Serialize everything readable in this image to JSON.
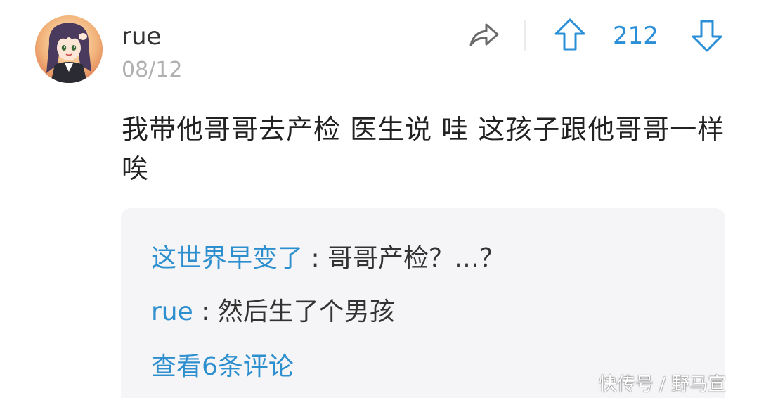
{
  "post": {
    "username": "rue",
    "date": "08/12",
    "body": "我带他哥哥去产检 医生说 哇 这孩子跟他哥哥一样唉",
    "score": "212",
    "icons": {
      "share": "share-icon",
      "upvote": "upvote-arrow-icon",
      "downvote": "downvote-arrow-icon"
    }
  },
  "replies": {
    "items": [
      {
        "author": "这世界早变了",
        "separator": " : ",
        "text": "哥哥产检？…？"
      },
      {
        "author": "rue",
        "separator": " : ",
        "text": "然后生了个男孩"
      }
    ],
    "more_label": "查看6条评论"
  },
  "watermark": "快传号 / 野马宣",
  "colors": {
    "accent": "#2e8fcf",
    "score": "#2a8fd6",
    "reply_bg": "#f5f5f7",
    "date": "#b0b0b0"
  }
}
